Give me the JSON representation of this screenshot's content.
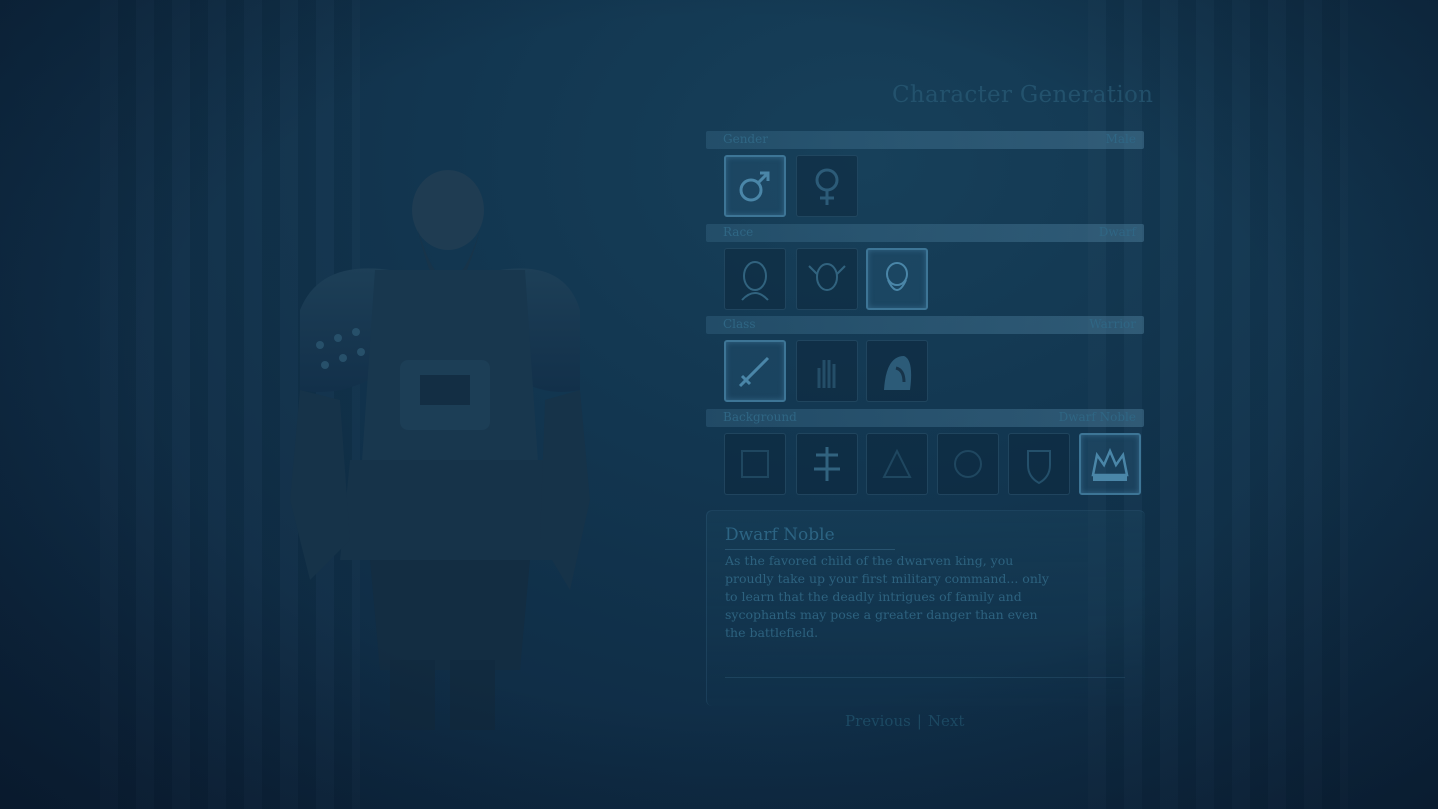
{
  "screen": {
    "title": "Character Generation"
  },
  "sections": {
    "gender": {
      "label": "Gender",
      "value": "Male",
      "options": [
        "male",
        "female"
      ],
      "selected_index": 0
    },
    "race": {
      "label": "Race",
      "value": "Dwarf",
      "options": [
        "human",
        "elf",
        "dwarf"
      ],
      "selected_index": 2
    },
    "class": {
      "label": "Class",
      "value": "Warrior",
      "options": [
        "warrior",
        "mage",
        "rogue"
      ],
      "selected_index": 0
    },
    "background": {
      "label": "Background",
      "value": "Dwarf Noble",
      "options": [
        "background-1",
        "background-2",
        "background-3",
        "background-4",
        "background-5",
        "dwarf-noble"
      ],
      "selected_index": 5
    }
  },
  "description": {
    "title": "Dwarf Noble",
    "text": "As the favored child of the dwarven king, you proudly take up your first military command... only to learn that the deadly intrigues of family and sycophants may pose a greater danger than even the battlefield."
  },
  "navigation": {
    "previous_label": "Previous",
    "separator": "|",
    "next_label": "Next"
  },
  "colors": {
    "background": "#123650",
    "text": "#2d627f",
    "selected_border": "#3d7596"
  }
}
